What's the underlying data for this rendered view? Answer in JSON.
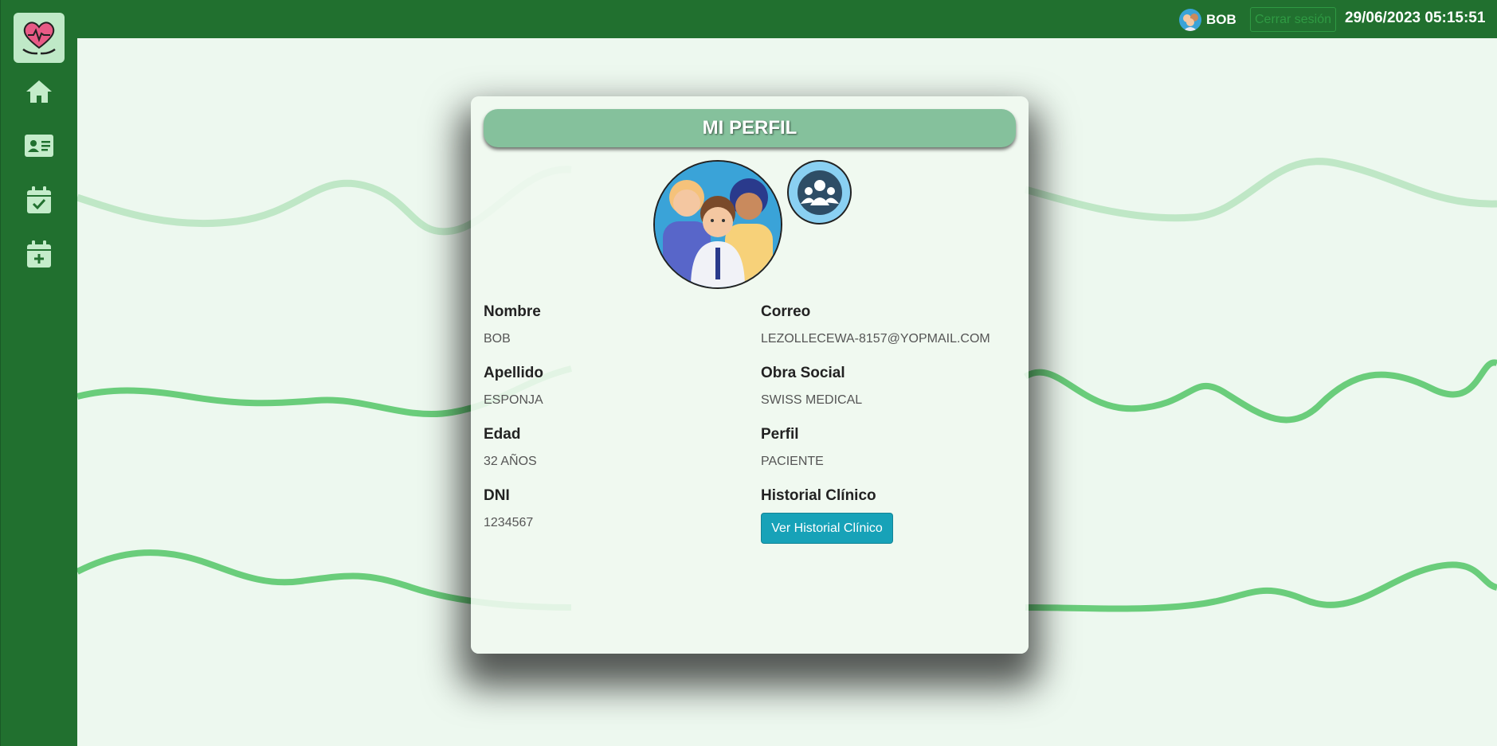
{
  "header": {
    "user_name": "BOB",
    "logout_label": "Cerrar sesión",
    "datetime": "29/06/2023 05:15:51"
  },
  "sidebar": {
    "items": [
      {
        "icon": "home-icon"
      },
      {
        "icon": "id-card-icon"
      },
      {
        "icon": "calendar-check-icon"
      },
      {
        "icon": "calendar-plus-icon"
      }
    ]
  },
  "profile": {
    "title": "MI PERFIL",
    "fields": {
      "nombre": {
        "label": "Nombre",
        "value": "BOB"
      },
      "correo": {
        "label": "Correo",
        "value": "LEZOLLECEWA-8157@YOPMAIL.COM"
      },
      "apellido": {
        "label": "Apellido",
        "value": "ESPONJA"
      },
      "obra_social": {
        "label": "Obra Social",
        "value": "SWISS MEDICAL"
      },
      "edad": {
        "label": "Edad",
        "value": "32 AÑOS"
      },
      "perfil": {
        "label": "Perfil",
        "value": "PACIENTE"
      },
      "dni": {
        "label": "DNI",
        "value": "1234567"
      },
      "historial": {
        "label": "Historial Clínico",
        "button_label": "Ver Historial Clínico"
      }
    }
  },
  "colors": {
    "topbar": "#21702f",
    "background": "#edf8ef",
    "card_header": "#85c19c",
    "button": "#17a2b8",
    "wave": "#5cc46f"
  }
}
